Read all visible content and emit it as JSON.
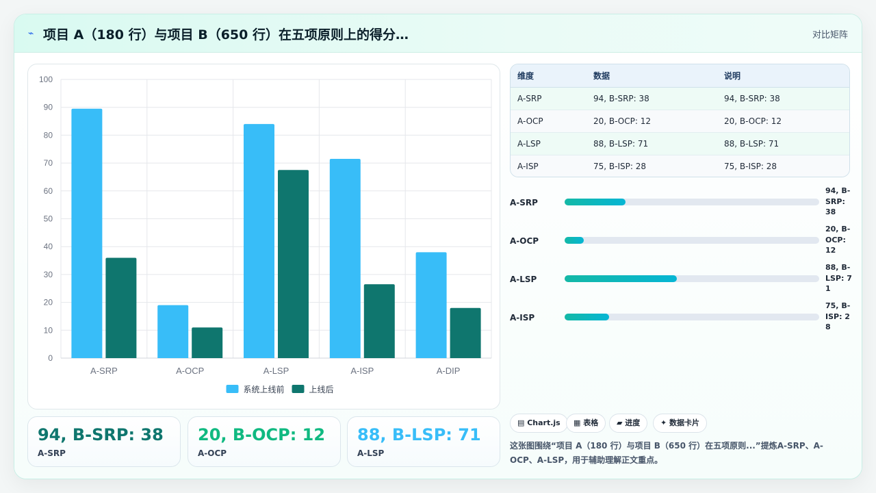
{
  "header": {
    "title": "项目 A（180 行）与项目 B（650 行）在五项原则上的得分…",
    "tag": "对比矩阵",
    "icon": "bolt-icon"
  },
  "colors": {
    "series_before": "#38bdf8",
    "series_after": "#0f766e",
    "card_dark": "#0f766e",
    "card_green": "#10b981",
    "card_blue": "#38bdf8"
  },
  "chart_data": {
    "type": "bar",
    "categories": [
      "A-SRP",
      "A-OCP",
      "A-LSP",
      "A-ISP",
      "A-DIP"
    ],
    "series": [
      {
        "name": "系统上线前",
        "values": [
          89.5,
          19,
          84,
          71.5,
          38
        ]
      },
      {
        "name": "上线后",
        "values": [
          36,
          11,
          67.5,
          26.5,
          18
        ]
      }
    ],
    "ylim": [
      0,
      100
    ],
    "yticks": [
      "0",
      "10",
      "20",
      "30",
      "40",
      "50",
      "60",
      "70",
      "80",
      "90",
      "100"
    ],
    "grid": true,
    "legend": "bottom"
  },
  "stat_cards": [
    {
      "value": "94, B-SRP: 38",
      "label": "A-SRP"
    },
    {
      "value": "20, B-OCP: 12",
      "label": "A-OCP"
    },
    {
      "value": "88, B-LSP: 71",
      "label": "A-LSP"
    }
  ],
  "table": {
    "headers": [
      "维度",
      "数据",
      "说明"
    ],
    "rows": [
      [
        "A-SRP",
        "94, B-SRP: 38",
        "94, B-SRP: 38"
      ],
      [
        "A-OCP",
        "20, B-OCP: 12",
        "20, B-OCP: 12"
      ],
      [
        "A-LSP",
        "88, B-LSP: 71",
        "88, B-LSP: 71"
      ],
      [
        "A-ISP",
        "75, B-ISP: 28",
        "75, B-ISP: 28"
      ]
    ]
  },
  "progress": [
    {
      "label": "A-SRP",
      "value": "94, B-SRP: 38",
      "fraction": 0.24
    },
    {
      "label": "A-OCP",
      "value": "20, B-OCP: 12",
      "fraction": 0.075
    },
    {
      "label": "A-LSP",
      "value": "88, B-LSP: 71",
      "fraction": 0.44
    },
    {
      "label": "A-ISP",
      "value": "75, B-ISP: 28",
      "fraction": 0.175
    }
  ],
  "chips": [
    {
      "label": "▤ Chart.js"
    },
    {
      "label": "▦ 表格"
    },
    {
      "label": "▰ 进度"
    },
    {
      "label": "✦ 数据卡片"
    }
  ],
  "summary": "这张图围绕“项目 A（180 行）与项目 B（650 行）在五项原则...”提炼A-SRP、A-OCP、A-LSP，用于辅助理解正文重点。"
}
